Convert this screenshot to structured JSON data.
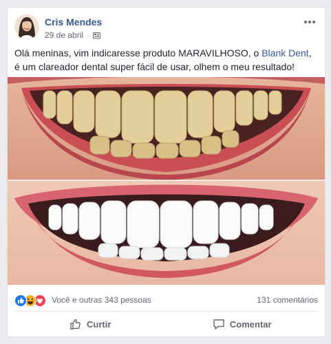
{
  "post": {
    "author": "Cris Mendes",
    "date": "29 de abril",
    "separator": "·",
    "text_before_link": "Olá meninas, vim indicaresse produto MARAVILHOSO, o ",
    "link_text": "Blank Dent",
    "text_after_link": ", é um clareador dental super fácil de usar, olhem o meu resultado!"
  },
  "reactions": {
    "icons": [
      "like-icon",
      "haha-icon",
      "love-icon"
    ],
    "summary": "Você e outras 343 pessoas",
    "comments": "131 comentários"
  },
  "actions": {
    "like_label": "Curtir",
    "comment_label": "Comentar"
  },
  "colors": {
    "link": "#365899",
    "like": "#2078f4",
    "love": "#f33e58",
    "haha": "#f7b125"
  }
}
